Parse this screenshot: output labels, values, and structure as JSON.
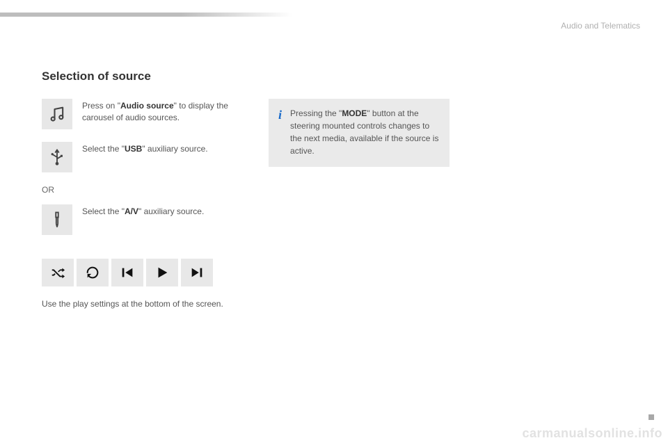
{
  "header": {
    "category": "Audio and Telematics"
  },
  "section": {
    "title": "Selection of source"
  },
  "steps": {
    "audio_source": {
      "pre": "Press on \"",
      "bold": "Audio source",
      "post": "\" to display the carousel of audio sources."
    },
    "usb": {
      "pre": "Select the \"",
      "bold": "USB",
      "post": "\" auxiliary source."
    },
    "or": "OR",
    "av": {
      "pre": "Select the \"",
      "bold": "A/V",
      "post": "\" auxiliary source."
    }
  },
  "footer_note": "Use the play settings at the bottom of the screen.",
  "info": {
    "pre": "Pressing the \"",
    "bold": "MODE",
    "post": "\" button at the steering mounted controls changes to the next media, available if the source is active."
  },
  "play_controls": [
    "shuffle",
    "repeat",
    "previous",
    "play",
    "next"
  ],
  "watermark": "carmanualsonline.info"
}
